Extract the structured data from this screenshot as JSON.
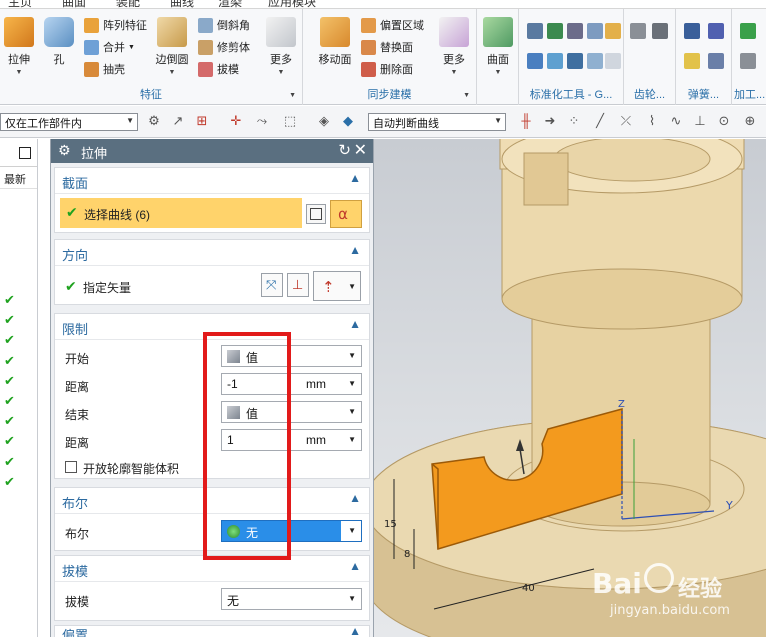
{
  "menu": {
    "items": [
      "主页",
      "曲面",
      "装配",
      "曲线",
      "渲染",
      "应用模块"
    ]
  },
  "ribbon": {
    "feature_group": {
      "label": "特征",
      "extrude_label": "拉伸",
      "hole_label": "孔",
      "pattern_label": "阵列特征",
      "combine_label": "合并",
      "shell_label": "抽壳",
      "edge_blend_label": "边倒圆",
      "chamfer_label": "倒斜角",
      "trim_body_label": "修剪体",
      "draft_label": "拔模",
      "more_label": "更多"
    },
    "sync_group": {
      "label": "同步建模",
      "move_face_label": "移动面",
      "offset_region_label": "偏置区域",
      "replace_face_label": "替换面",
      "delete_face_label": "删除面",
      "more_label": "更多"
    },
    "surface_group": {
      "surface_label": "曲面"
    },
    "standard_tools_label": "标准化工具 - G...",
    "gear_label": "齿轮...",
    "spring_label": "弹簧...",
    "machining_label": "加工..."
  },
  "selection_bar": {
    "filter_value": "仅在工作部件内",
    "curve_rule_value": "自动判断曲线"
  },
  "navigator": {
    "column_label": "最新",
    "check_count": 10
  },
  "dialog": {
    "title": "拉伸",
    "section": {
      "title": "截面",
      "select_curve_label": "选择曲线 (6)"
    },
    "direction": {
      "title": "方向",
      "vector_label": "指定矢量"
    },
    "limits": {
      "title": "限制",
      "start_label": "开始",
      "start_value": "值",
      "start_distance_label": "距离",
      "start_distance_value": "-1",
      "start_unit": "mm",
      "end_label": "结束",
      "end_value": "值",
      "end_distance_label": "距离",
      "end_distance_value": "1",
      "end_unit": "mm",
      "open_profile_label": "开放轮廓智能体积"
    },
    "boolean": {
      "title": "布尔",
      "label": "布尔",
      "value": "无"
    },
    "draft": {
      "title": "拔模",
      "label": "拔模",
      "value": "无"
    },
    "offset": {
      "title": "偏置"
    }
  },
  "viewport": {
    "dim_40": "40",
    "dim_15": "15",
    "dim_8": "8",
    "axis_y": "Y",
    "axis_z": "Z"
  },
  "watermark": {
    "brand": "Bai",
    "brand_suffix": "经验",
    "url": "jingyan.baidu.com"
  },
  "colors": {
    "ribbon_group_label": "#2a6fa8",
    "selected_row": "#ffd36b",
    "boolean_highlight": "#2a8ee8",
    "highlight_box": "#e21a1a",
    "extrude_orange": "#f39a1e"
  }
}
